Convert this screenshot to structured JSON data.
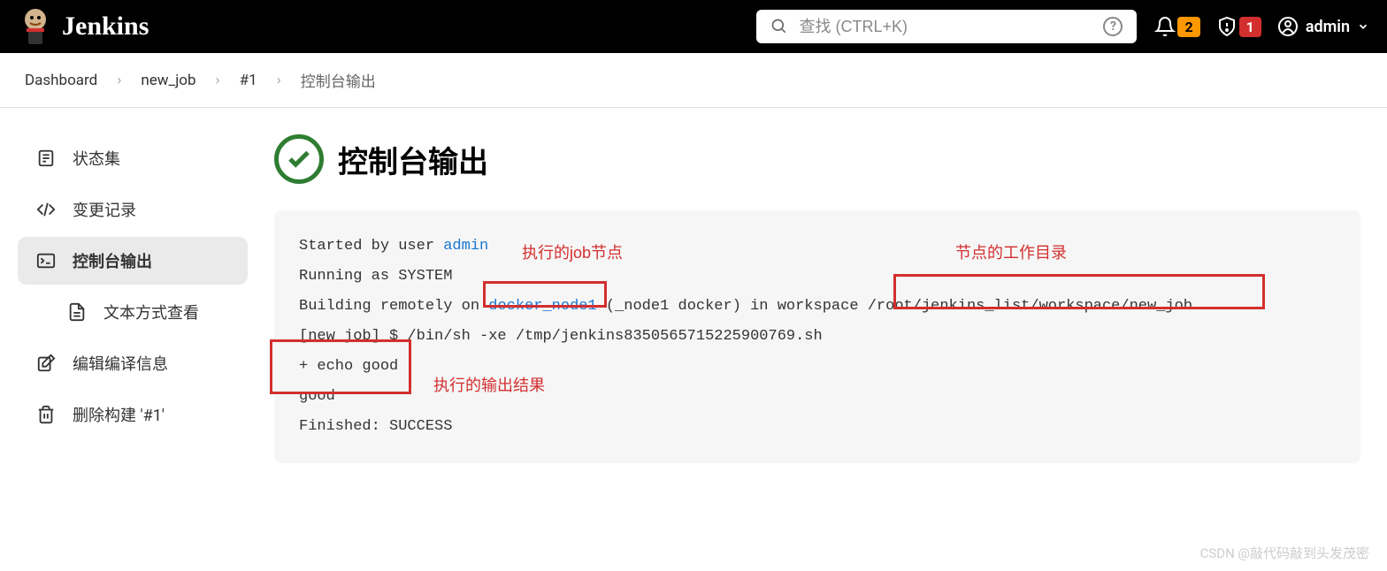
{
  "header": {
    "brand": "Jenkins",
    "search_placeholder": "查找 (CTRL+K)",
    "notif_count": "2",
    "alert_count": "1",
    "username": "admin"
  },
  "breadcrumb": {
    "items": [
      "Dashboard",
      "new_job",
      "#1",
      "控制台输出"
    ]
  },
  "sidebar": {
    "items": [
      {
        "label": "状态集"
      },
      {
        "label": "变更记录"
      },
      {
        "label": "控制台输出"
      },
      {
        "label": "文本方式查看"
      },
      {
        "label": "编辑编译信息"
      },
      {
        "label": "删除构建 '#1'"
      }
    ]
  },
  "page": {
    "title": "控制台输出"
  },
  "console": {
    "line1_prefix": "Started by user ",
    "line1_user": "admin",
    "line2": "Running as SYSTEM",
    "line3_prefix": "Building remotely on ",
    "line3_node": "docker_node1",
    "line3_middle": " (_node1 docker) in workspace ",
    "line3_workspace": "/root/jenkins_list/workspace/new_job",
    "line4": "[new_job] $ /bin/sh -xe /tmp/jenkins8350565715225900769.sh",
    "line5": "+ echo good",
    "line6": "good",
    "line7": "Finished: SUCCESS"
  },
  "annotations": {
    "a1": "执行的job节点",
    "a2": "节点的工作目录",
    "a3": "执行的输出结果"
  },
  "watermark": "CSDN @敲代码敲到头发茂密"
}
